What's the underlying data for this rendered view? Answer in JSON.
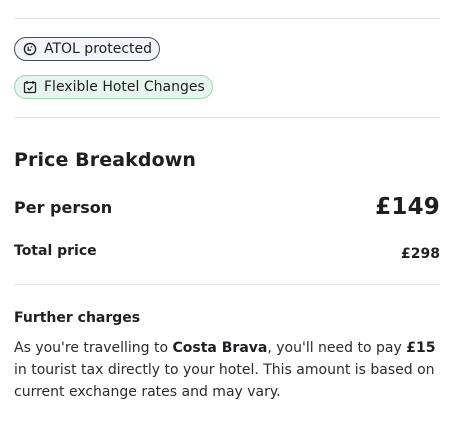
{
  "badges": {
    "atol": {
      "label": "ATOL protected",
      "icon": "atol-shield-icon"
    },
    "flexible": {
      "label": "Flexible Hotel Changes",
      "icon": "calendar-check-icon"
    }
  },
  "price": {
    "title": "Price Breakdown",
    "per_person_label": "Per person",
    "per_person_value": "£149",
    "total_label": "Total price",
    "total_value": "£298"
  },
  "further_charges": {
    "title": "Further charges",
    "text_1": "As you're travelling to ",
    "destination": "Costa Brava",
    "text_2": ", you'll need to pay ",
    "amount": "£15",
    "text_3": " in tourist tax directly to your hotel. This amount is based on current exchange rates and may vary."
  },
  "colors": {
    "text": "#1f1f23",
    "divider": "#e4e4e8",
    "atol_bg": "#f3f3fa",
    "flex_bg": "#e6f6ee",
    "flex_border": "#9ed7b8"
  }
}
